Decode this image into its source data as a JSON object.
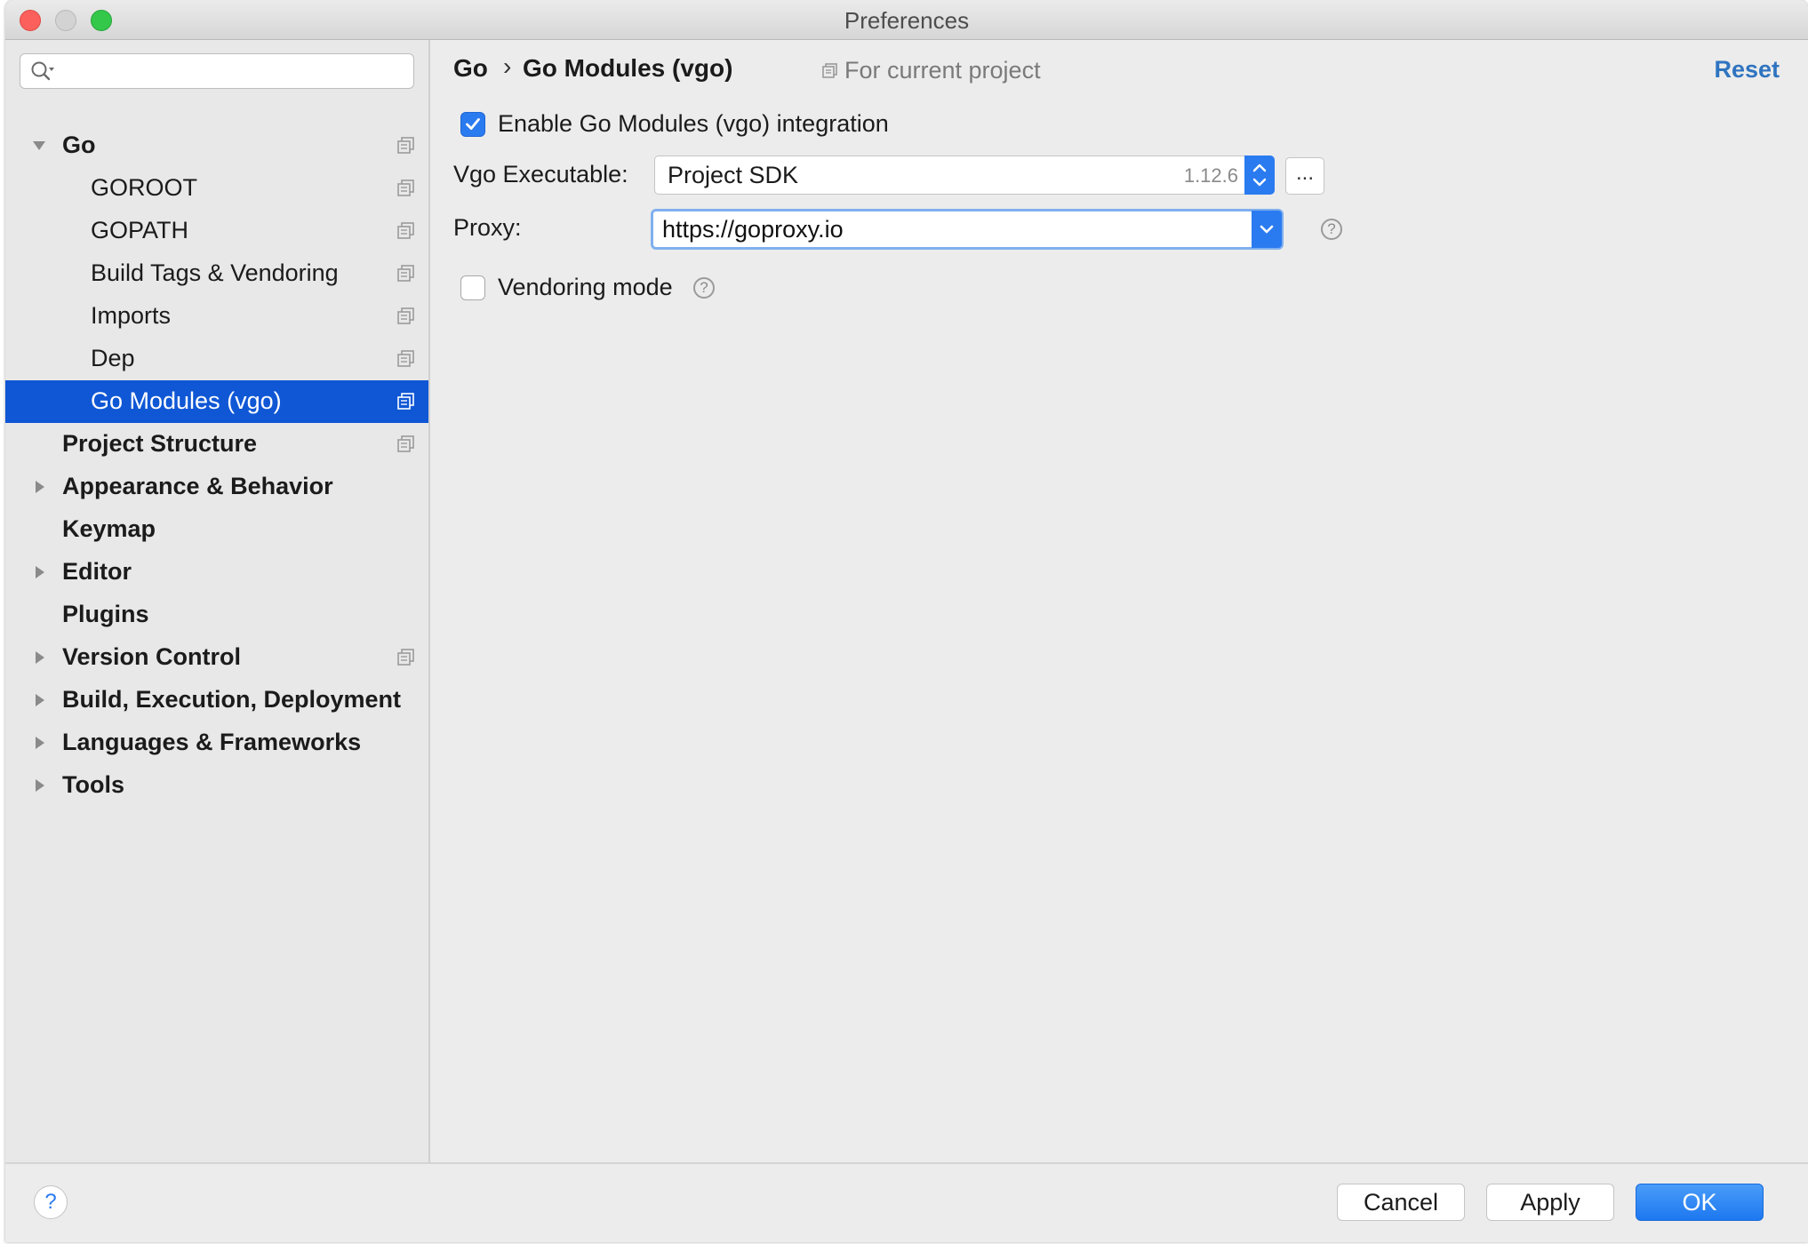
{
  "window": {
    "title": "Preferences"
  },
  "sidebar": {
    "search": {
      "placeholder": "",
      "value": ""
    },
    "items": [
      {
        "label": "Go",
        "level": 0,
        "bold": true,
        "expanded": true,
        "has_arrow": true,
        "project_icon": true,
        "selected": false
      },
      {
        "label": "GOROOT",
        "level": 1,
        "bold": false,
        "project_icon": true,
        "selected": false
      },
      {
        "label": "GOPATH",
        "level": 1,
        "bold": false,
        "project_icon": true,
        "selected": false
      },
      {
        "label": "Build Tags & Vendoring",
        "level": 1,
        "bold": false,
        "project_icon": true,
        "selected": false
      },
      {
        "label": "Imports",
        "level": 1,
        "bold": false,
        "project_icon": true,
        "selected": false
      },
      {
        "label": "Dep",
        "level": 1,
        "bold": false,
        "project_icon": true,
        "selected": false
      },
      {
        "label": "Go Modules (vgo)",
        "level": 1,
        "bold": false,
        "project_icon": true,
        "selected": true
      },
      {
        "label": "Project Structure",
        "level": 0,
        "bold": true,
        "has_arrow": false,
        "project_icon": true,
        "selected": false
      },
      {
        "label": "Appearance & Behavior",
        "level": 0,
        "bold": true,
        "has_arrow": true,
        "project_icon": false,
        "selected": false
      },
      {
        "label": "Keymap",
        "level": 0,
        "bold": true,
        "has_arrow": false,
        "project_icon": false,
        "selected": false
      },
      {
        "label": "Editor",
        "level": 0,
        "bold": true,
        "has_arrow": true,
        "project_icon": false,
        "selected": false
      },
      {
        "label": "Plugins",
        "level": 0,
        "bold": true,
        "has_arrow": false,
        "project_icon": false,
        "selected": false
      },
      {
        "label": "Version Control",
        "level": 0,
        "bold": true,
        "has_arrow": true,
        "project_icon": true,
        "selected": false
      },
      {
        "label": "Build, Execution, Deployment",
        "level": 0,
        "bold": true,
        "has_arrow": true,
        "project_icon": false,
        "selected": false
      },
      {
        "label": "Languages & Frameworks",
        "level": 0,
        "bold": true,
        "has_arrow": true,
        "project_icon": false,
        "selected": false
      },
      {
        "label": "Tools",
        "level": 0,
        "bold": true,
        "has_arrow": true,
        "project_icon": false,
        "selected": false
      }
    ]
  },
  "content": {
    "breadcrumb": {
      "parent": "Go",
      "separator": "›",
      "page": "Go Modules (vgo)"
    },
    "scope_label": "For current project",
    "reset_label": "Reset",
    "enable_checkbox": {
      "label": "Enable Go Modules (vgo) integration",
      "checked": true
    },
    "vgo_executable": {
      "label": "Vgo Executable:",
      "value": "Project SDK",
      "version": "1.12.6",
      "browse_label": "..."
    },
    "proxy": {
      "label": "Proxy:",
      "value": "https://goproxy.io"
    },
    "vendoring_checkbox": {
      "label": "Vendoring mode",
      "checked": false
    },
    "help_glyph": "?"
  },
  "footer": {
    "help_glyph": "?",
    "cancel_label": "Cancel",
    "apply_label": "Apply",
    "ok_label": "OK"
  },
  "colors": {
    "selection": "#0f57d5",
    "accent": "#2b7bf0",
    "link": "#2f74c0"
  }
}
